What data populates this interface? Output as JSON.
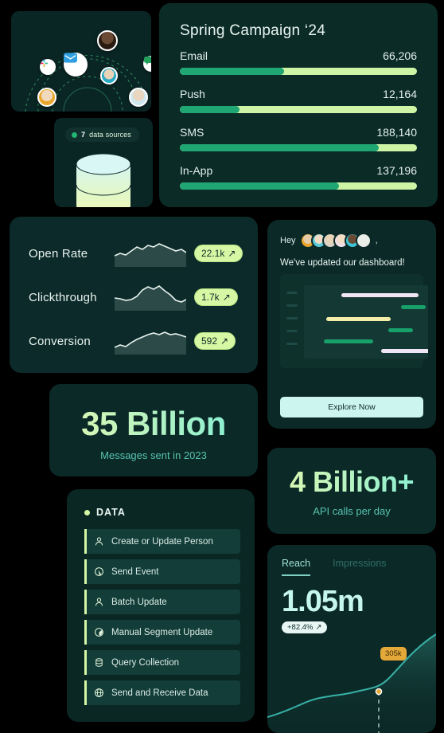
{
  "network": {
    "label": "customer-network-graph",
    "app_icons": [
      "slack-icon",
      "email-icon",
      "chat-icon"
    ]
  },
  "sources": {
    "count": "7",
    "label": "data sources"
  },
  "campaign": {
    "title": "Spring Campaign ‘24",
    "channels": [
      {
        "name": "Email",
        "value": "66,206",
        "pct": 44
      },
      {
        "name": "Push",
        "value": "12,164",
        "pct": 25
      },
      {
        "name": "SMS",
        "value": "188,140",
        "pct": 84
      },
      {
        "name": "In-App",
        "value": "137,196",
        "pct": 67
      }
    ]
  },
  "metrics": [
    {
      "label": "Open Rate",
      "value": "22.1k",
      "trend": "↗"
    },
    {
      "label": "Clickthrough",
      "value": "1.7k",
      "trend": "↗"
    },
    {
      "label": "Conversion",
      "value": "592",
      "trend": "↗"
    }
  ],
  "update": {
    "greeting": "Hey",
    "greeting_end": ",",
    "message": "We've updated our dashboard!",
    "button": "Explore Now"
  },
  "stats": {
    "messages": {
      "number": "35 Billion",
      "caption": "Messages sent in 2023"
    },
    "api": {
      "number": "4 Billion+",
      "caption": "API calls per day"
    }
  },
  "data_panel": {
    "heading": "DATA",
    "items": [
      {
        "label": "Create or Update Person",
        "icon": "person-icon"
      },
      {
        "label": "Send Event",
        "icon": "cursor-click-icon"
      },
      {
        "label": "Batch Update",
        "icon": "person-icon"
      },
      {
        "label": "Manual Segment Update",
        "icon": "segment-pie-icon"
      },
      {
        "label": "Query Collection",
        "icon": "database-icon"
      },
      {
        "label": "Send and Receive Data",
        "icon": "globe-icon"
      }
    ]
  },
  "reach": {
    "tabs": [
      {
        "label": "Reach",
        "active": true
      },
      {
        "label": "Impressions",
        "active": false
      }
    ],
    "value": "1.05m",
    "change": "+82.4%",
    "change_arrow": "↗",
    "tooltip": "305k"
  },
  "colors": {
    "page_bg": "#000000",
    "card_bg": "#0b2927",
    "bar_fill": "#1fa673",
    "bar_track": "#cdf5a5",
    "lime": "#d6f7a3",
    "cyan": "#7fd0c2",
    "orange": "#e5a93a"
  },
  "chart_data": [
    {
      "type": "bar",
      "title": "Spring Campaign ‘24",
      "categories": [
        "Email",
        "Push",
        "SMS",
        "In-App"
      ],
      "values": [
        66206,
        12164,
        188140,
        137196
      ],
      "fill_pct": [
        44,
        25,
        84,
        67
      ],
      "orientation": "horizontal",
      "grid": false,
      "legend": "none"
    },
    {
      "type": "line",
      "title": "Open Rate",
      "value_label": "22.1k",
      "y": [
        30,
        34,
        31,
        38,
        44,
        41,
        47,
        45,
        50,
        46,
        43,
        40,
        42,
        38
      ],
      "grid": false
    },
    {
      "type": "line",
      "title": "Clickthrough",
      "value_label": "1.7k",
      "y": [
        34,
        33,
        30,
        31,
        36,
        48,
        56,
        52,
        58,
        50,
        44,
        34,
        30,
        33
      ],
      "grid": false
    },
    {
      "type": "line",
      "title": "Conversion",
      "value_label": "592",
      "y": [
        22,
        26,
        24,
        30,
        36,
        40,
        44,
        47,
        45,
        48,
        44,
        46,
        43,
        40
      ],
      "grid": false
    },
    {
      "type": "line",
      "title": "Reach",
      "ylabel": "",
      "y": [
        8,
        12,
        18,
        24,
        30,
        33,
        34,
        36,
        44,
        56,
        72,
        86,
        96,
        104
      ],
      "annotations": [
        {
          "label": "305k",
          "x_pct": 68
        }
      ],
      "legend": "none",
      "grid": false
    },
    {
      "type": "bar",
      "title": "dashboard-preview-gantt",
      "orientation": "horizontal",
      "series": [
        {
          "name": "row1",
          "start_pct": 30,
          "width_pct": 62,
          "color": "#efe6f5"
        },
        {
          "name": "row2",
          "start_pct": 78,
          "width_pct": 20,
          "color": "#17a06a"
        },
        {
          "name": "row3",
          "start_pct": 18,
          "width_pct": 52,
          "color": "#f2eda8"
        },
        {
          "name": "row4",
          "start_pct": 68,
          "width_pct": 20,
          "color": "#17a06a"
        },
        {
          "name": "row5",
          "start_pct": 16,
          "width_pct": 40,
          "color": "#17a06a"
        },
        {
          "name": "row6",
          "start_pct": 62,
          "width_pct": 40,
          "color": "#efe6f5"
        },
        {
          "name": "row7",
          "start_pct": 18,
          "width_pct": 16,
          "color": "#17a06a"
        }
      ],
      "grid": false
    }
  ]
}
